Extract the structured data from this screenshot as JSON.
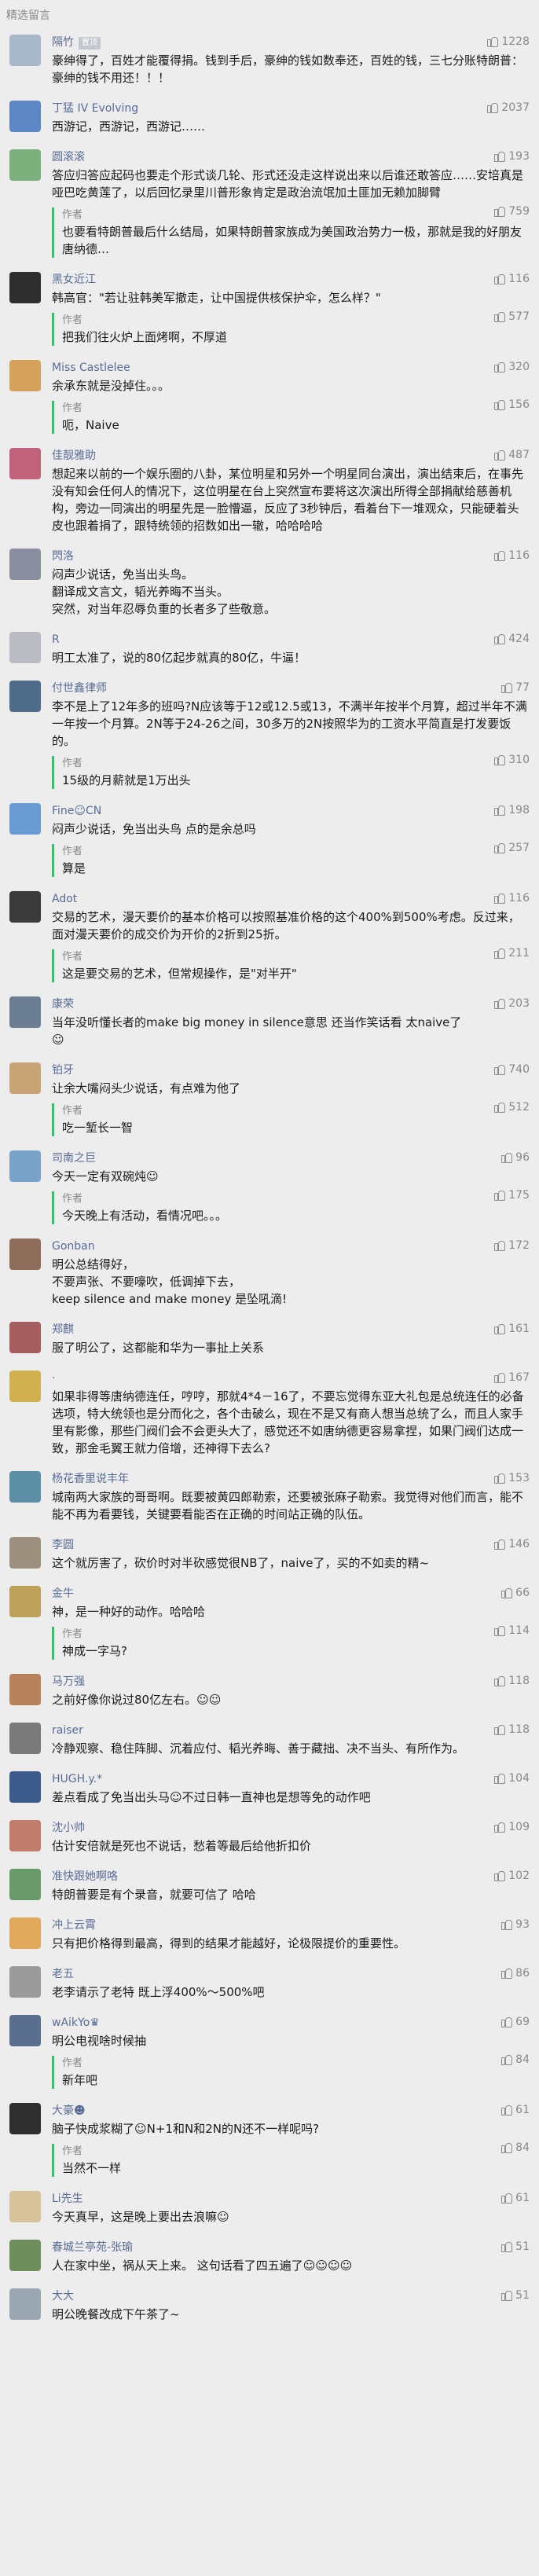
{
  "header": {
    "title": "精选留言"
  },
  "comments": [
    {
      "name": "隔竹",
      "badge": "置顶",
      "likes": "1228",
      "avatar_color": "#a8b8c8",
      "text": "豪绅得了，百姓才能覆得捐。钱到手后，豪绅的钱如数奉还，百姓的钱，三七分账特朗普：豪绅的钱不用还！！！",
      "reply": null
    },
    {
      "name": "丁猛 IV Evolving",
      "likes": "2037",
      "avatar_color": "#5d87c4",
      "text": "西游记，西游记，西游记……",
      "reply": null
    },
    {
      "name": "圆滚滚",
      "likes": "193",
      "avatar_color": "#7cb07c",
      "text": "答应归答应起码也要走个形式谈几轮、形式还没走这样说出来以后谁还敢答应……安培真是哑巴吃黄莲了，以后回忆录里川普形象肯定是政治流氓加土匪加无赖加脚臂",
      "reply": {
        "label": "作者",
        "likes": "759",
        "text": "也要看特朗普最后什么结局，如果特朗普家族成为美国政治势力一极，那就是我的好朋友唐纳德…"
      }
    },
    {
      "name": "黑女近江",
      "likes": "116",
      "avatar_color": "#2e2e2e",
      "text": "韩高官：\"若让驻韩美军撤走，让中国提供核保护伞，怎么样？\"",
      "reply": {
        "label": "作者",
        "likes": "577",
        "text": "把我们往火炉上面烤啊，不厚道"
      }
    },
    {
      "name": "Miss Castlelee",
      "likes": "320",
      "avatar_color": "#d4a25a",
      "text": "余承东就是没掉住。。。",
      "reply": {
        "label": "作者",
        "likes": "156",
        "text": "呃，Naive"
      }
    },
    {
      "name": "佳靓雅助",
      "likes": "487",
      "avatar_color": "#c0627a",
      "text": "想起来以前的一个娱乐圈的八卦，某位明星和另外一个明星同台演出，演出结束后，在事先没有知会任何人的情况下，这位明星在台上突然宣布要将这次演出所得全部捐献给慈善机构，旁边一同演出的明星先是一脸懵逼，反应了3秒钟后，看着台下一堆观众，只能硬着头皮也跟着捐了，跟特统领的招数如出一辙，哈哈哈哈",
      "reply": null
    },
    {
      "name": "閃洛",
      "likes": "116",
      "avatar_color": "#8a8fa0",
      "text": "闷声少说话，免当出头鸟。\n翻译成文言文，韬光养晦不当头。\n突然，对当年忍辱负重的长者多了些敬意。",
      "reply": null
    },
    {
      "name": "R",
      "likes": "424",
      "avatar_color": "#b9bcc2",
      "text": "明工太准了，说的80亿起步就真的80亿，牛逼！",
      "reply": null
    },
    {
      "name": "付世鑫律师",
      "likes": "77",
      "avatar_color": "#4f6b8a",
      "text": "李不是上了12年多的班吗?N应该等于12或12.5或13，不满半年按半个月算，超过半年不满一年按一个月算。2N等于24-26之间，30多万的2N按照华为的工资水平简直是打发要饭的。",
      "reply": {
        "label": "作者",
        "likes": "310",
        "text": "15级的月薪就是1万出头"
      }
    },
    {
      "name": "Fine☺CN",
      "likes": "198",
      "avatar_color": "#6a9bd2",
      "text": "闷声少说话，免当出头鸟 点的是余总吗",
      "reply": {
        "label": "作者",
        "likes": "257",
        "text": "算是"
      }
    },
    {
      "name": "Adot",
      "likes": "116",
      "avatar_color": "#3a3a3a",
      "text": "交易的艺术，漫天要价的基本价格可以按照基准价格的这个400%到500%考虑。反过来，面对漫天要价的成交价为开价的2折到25折。",
      "reply": {
        "label": "作者",
        "likes": "211",
        "text": "这是要交易的艺术，但常规操作，是\"对半开\""
      }
    },
    {
      "name": "康荣",
      "likes": "203",
      "avatar_color": "#6b7e92",
      "text": "当年没听懂长者的make big money in silence意思 还当作笑话看 太naive了\n☺",
      "reply": null
    },
    {
      "name": "铂牙",
      "likes": "740",
      "avatar_color": "#c7a376",
      "text": "让余大嘴闷头少说话，有点难为他了",
      "reply": {
        "label": "作者",
        "likes": "512",
        "text": "吃一堑长一智"
      }
    },
    {
      "name": "司南之巨",
      "likes": "96",
      "avatar_color": "#7aa3c9",
      "text": "今天一定有双碗炖☺",
      "reply": {
        "label": "作者",
        "likes": "175",
        "text": "今天晚上有活动，看情况吧。。。"
      }
    },
    {
      "name": "Gonban",
      "likes": "172",
      "avatar_color": "#8d6d5a",
      "text": "明公总结得好，\n不要声张、不要嚎吹，低调掉下去，\nkeep silence and make money 是坠吼滴!",
      "reply": null
    },
    {
      "name": "郑麒",
      "likes": "161",
      "avatar_color": "#a55e5e",
      "text": "服了明公了，这都能和华为一事扯上关系",
      "reply": null
    },
    {
      "name": "·",
      "likes": "167",
      "avatar_color": "#d1b050",
      "text": "如果非得等唐纳德连任，哼哼，那就4*4－16了，不要忘觉得东亚大礼包是总统连任的必备选项，特大统领也是分而化之，各个击破么，现在不是又有商人想当总统了么，而且人家手里有影像，那些门阀们会不会更头大了，感觉还不如唐纳德更容易拿捏，如果门阀们达成一致，那金毛翼王就力倍增，还神得下去么?",
      "reply": null
    },
    {
      "name": "杨花香里说丰年",
      "likes": "153",
      "avatar_color": "#5c8fa6",
      "text": "城南两大家族的哥哥啊。既要被黄四郎勒索，还要被张麻子勒索。我觉得对他们而言，能不能不再为看要钱，关键要看能否在正确的时间站正确的队伍。",
      "reply": null
    },
    {
      "name": "李圆",
      "likes": "146",
      "avatar_color": "#9c8f7d",
      "text": "这个就厉害了，砍价时对半砍感觉很NB了，naive了，买的不如卖的精~",
      "reply": null
    },
    {
      "name": "金牛",
      "likes": "66",
      "avatar_color": "#bda15b",
      "text": "神，是一种好的动作。哈哈哈",
      "reply": {
        "label": "作者",
        "likes": "114",
        "text": "神成一字马?"
      }
    },
    {
      "name": "马万强",
      "likes": "118",
      "avatar_color": "#b8825d",
      "text": "之前好像你说过80亿左右。☺☺",
      "reply": null
    },
    {
      "name": "raiser",
      "likes": "118",
      "avatar_color": "#7a7a7a",
      "text": "冷静观察、稳住阵脚、沉着应付、韬光养晦、善于藏拙、决不当头、有所作为。",
      "reply": null
    },
    {
      "name": "HUGH.y.*",
      "likes": "104",
      "avatar_color": "#3c5a8a",
      "text": "差点看成了免当出头马☺不过日韩一直神也是想等免的动作吧",
      "reply": null
    },
    {
      "name": "沈小帅",
      "likes": "109",
      "avatar_color": "#c27c6b",
      "text": "估计安倍就是死也不说话，愁着等最后给他折扣价",
      "reply": null
    },
    {
      "name": "准快跟她啊咯",
      "likes": "102",
      "avatar_color": "#6a9a6a",
      "text": "特朗普要是有个录音，就要可信了 哈哈",
      "reply": null
    },
    {
      "name": "冲上云霄",
      "likes": "93",
      "avatar_color": "#e0a85a",
      "text": "只有把价格得到最高，得到的结果才能越好，论极限提价的重要性。",
      "reply": null
    },
    {
      "name": "老五",
      "likes": "86",
      "avatar_color": "#9b9b9b",
      "text": "老李请示了老特 既上浮400%～500%吧",
      "reply": null
    },
    {
      "name": "wAikYo♛",
      "likes": "69",
      "avatar_color": "#5a6f8f",
      "text": "明公电视啥时候抽",
      "reply": {
        "label": "作者",
        "likes": "84",
        "text": "新年吧"
      }
    },
    {
      "name": "大豪☻",
      "likes": "61",
      "avatar_color": "#2f2f2f",
      "text": "脑子快成浆糊了☺N+1和N和2N的N还不一样呢吗?",
      "reply": {
        "label": "作者",
        "likes": "84",
        "text": "当然不一样"
      }
    },
    {
      "name": "Li先生",
      "likes": "61",
      "avatar_color": "#d6c29b",
      "text": "今天真早，这是晚上要出去浪嘛☺",
      "reply": null
    },
    {
      "name": "春城兰亭苑-张瑜",
      "likes": "51",
      "avatar_color": "#6e8f5c",
      "text": "人在家中坐，祸从天上来。 这句话看了四五遍了☺☺☺☺",
      "reply": null
    },
    {
      "name": "大大",
      "likes": "51",
      "avatar_color": "#9aa6b2",
      "text": "明公晚餐改成下午茶了~",
      "reply": null
    }
  ]
}
